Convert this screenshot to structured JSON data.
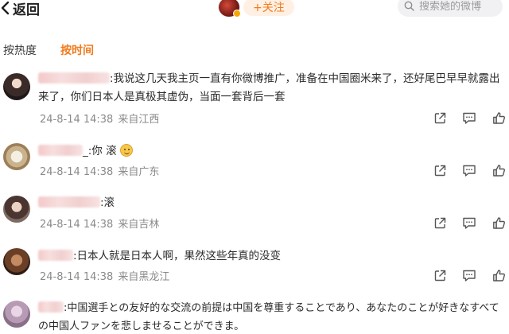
{
  "header": {
    "back_label": "返回",
    "follow_label": "+关注",
    "search_placeholder": "搜索她的微博"
  },
  "tabs": {
    "hot": "按热度",
    "time": "按时间"
  },
  "comments": [
    {
      "text": ":我说这几天我主页一直有你微博推广，准备在中国圈米来了，还好尾巴早早就露出来了，你们日本人是真极其虚伪，当面一套背后一套",
      "time": "24-8-14 14:38",
      "location": "来自江西"
    },
    {
      "text": "_:你 滚",
      "time": "24-8-14 14:38",
      "location": "来自广东"
    },
    {
      "text": ":滚",
      "time": "24-8-14 14:38",
      "location": "来自吉林"
    },
    {
      "text": ":日本人就是日本人啊，果然这些年真的没变",
      "time": "24-8-14 14:38",
      "location": "来自黑龙江"
    },
    {
      "text": ":中国選手との友好的な交流の前提は中国を尊重することであり、あなたのことが好きなすべての中国人ファンを悲しませることができま。"
    }
  ],
  "colors": {
    "accent": "#f27b1d",
    "meta": "#8a8a8a"
  }
}
